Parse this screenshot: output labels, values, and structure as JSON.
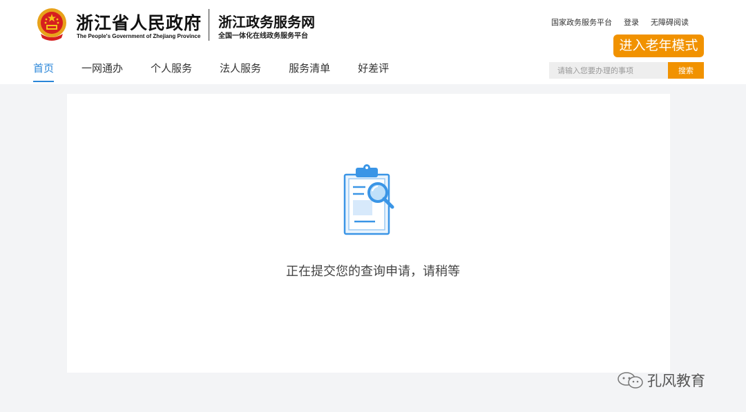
{
  "header": {
    "gov_name_cn": "浙江省人民政府",
    "gov_name_en": "The People's Government of Zhejiang Province",
    "site_name": "浙江政务服务网",
    "site_slogan": "全国一体化在线政务服务平台",
    "top_links": [
      {
        "label": "国家政务服务平台"
      },
      {
        "label": "登录"
      },
      {
        "label": "无障碍阅读"
      }
    ],
    "elder_mode_label": "进入老年模式"
  },
  "nav": {
    "items": [
      {
        "label": "首页",
        "active": true
      },
      {
        "label": "一网通办"
      },
      {
        "label": "个人服务"
      },
      {
        "label": "法人服务"
      },
      {
        "label": "服务清单"
      },
      {
        "label": "好差评"
      }
    ]
  },
  "search": {
    "placeholder": "请输入您要办理的事项",
    "button_label": "搜索"
  },
  "main": {
    "status_text": "正在提交您的查询申请，请稍等",
    "illustration_icon": "clipboard-search-icon"
  },
  "watermark": {
    "icon": "wechat-icon",
    "text": "孔风教育"
  },
  "colors": {
    "accent": "#f19200",
    "nav_active": "#2a86d8",
    "page_bg": "#f3f4f6"
  }
}
